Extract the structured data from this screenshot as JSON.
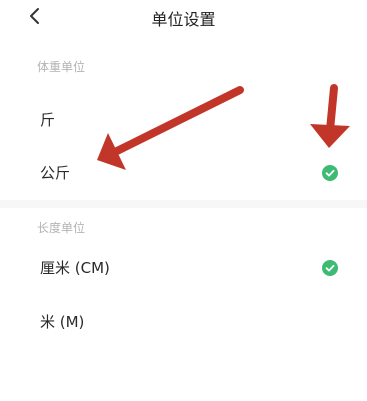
{
  "header": {
    "title": "单位设置",
    "back_icon": "chevron-left-icon"
  },
  "weight_section": {
    "label": "体重单位",
    "options": [
      {
        "label": "斤",
        "selected": false
      },
      {
        "label": "公斤",
        "selected": true
      }
    ]
  },
  "length_section": {
    "label": "长度单位",
    "options": [
      {
        "label": "厘米 (CM)",
        "selected": true
      },
      {
        "label": "米 (M)",
        "selected": false
      }
    ]
  },
  "colors": {
    "check": "#3dbb73",
    "arrow": "#c2362a",
    "section_label": "#b3b3b3"
  }
}
